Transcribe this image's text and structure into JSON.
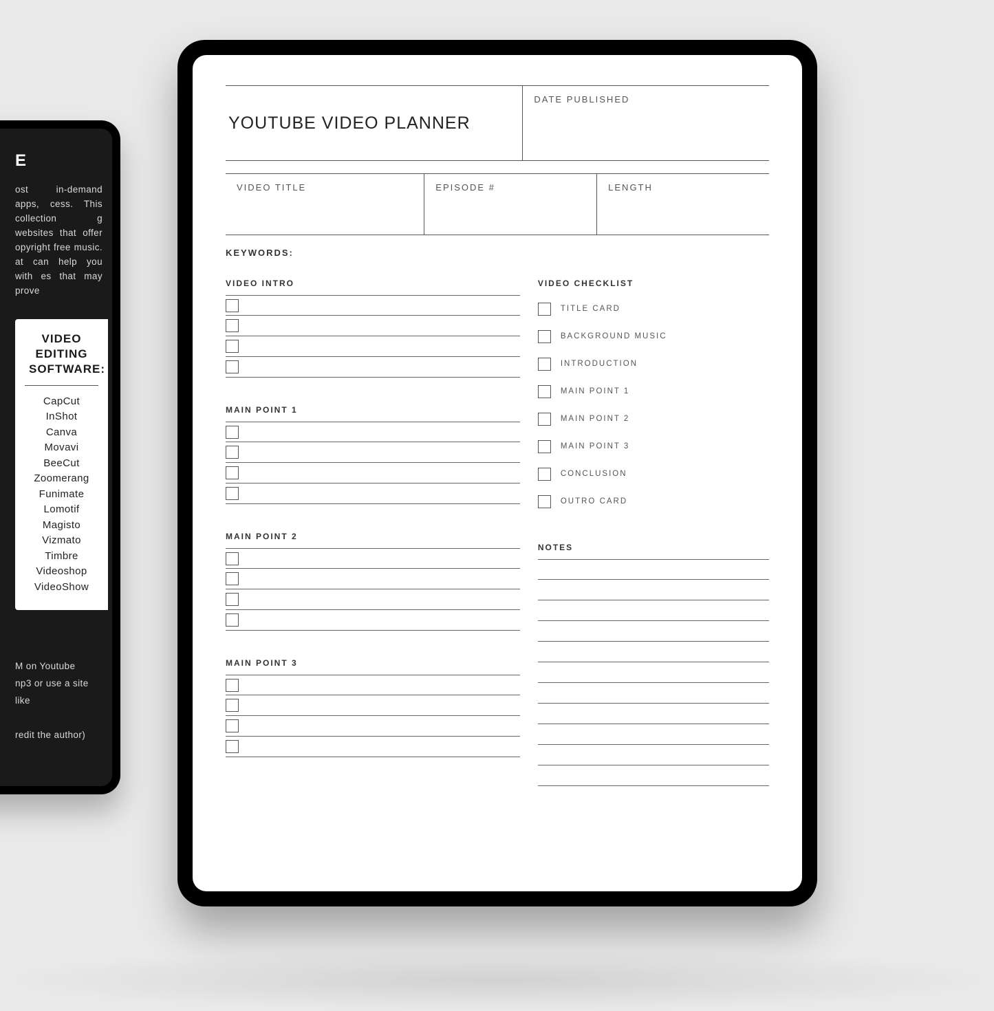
{
  "leftPanel": {
    "headingSuffix": "E",
    "intro": "ost in-demand apps, cess. This collection g websites that offer opyright free music. at can help you with es that may prove",
    "whiteCard": {
      "titleLine1": "VIDEO EDITING",
      "titleLine2": "SOFTWARE:",
      "items": [
        "CapCut",
        "InShot",
        "Canva",
        "Movavi",
        "BeeCut",
        "Zoomerang",
        "Funimate",
        "Lomotif",
        "Magisto",
        "Vizmato",
        "Timbre",
        "Videoshop",
        "VideoShow"
      ]
    },
    "bottomLines": [
      "M on Youtube",
      "np3 or use a site like",
      "",
      "redit the author)"
    ]
  },
  "planner": {
    "title": "YOUTUBE VIDEO PLANNER",
    "datePublishedLabel": "DATE PUBLISHED",
    "videoTitleLabel": "VIDEO TITLE",
    "episodeLabel": "EPISODE #",
    "lengthLabel": "LENGTH",
    "keywordsLabel": "KEYWORDS:",
    "sections": {
      "videoIntro": "VIDEO INTRO",
      "mainPoint1": "MAIN POINT 1",
      "mainPoint2": "MAIN POINT 2",
      "mainPoint3": "MAIN POINT 3",
      "videoChecklist": "VIDEO CHECKLIST",
      "notes": "NOTES"
    },
    "checklistItems": [
      "TITLE CARD",
      "BACKGROUND MUSIC",
      "INTRODUCTION",
      "MAIN POINT 1",
      "MAIN POINT 2",
      "MAIN POINT 3",
      "CONCLUSION",
      "OUTRO CARD"
    ],
    "introLines": 4,
    "pointLines": 4,
    "notesLines": 11
  }
}
